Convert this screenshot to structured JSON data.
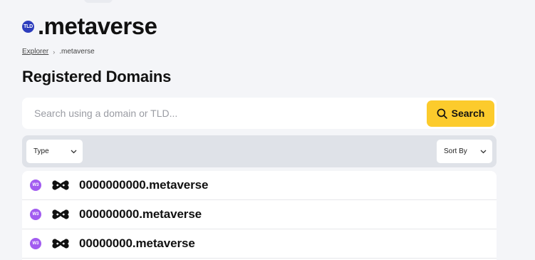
{
  "header": {
    "badge": "TLD",
    "title": ".metaverse"
  },
  "breadcrumb": {
    "root": "Explorer",
    "separator": "›",
    "current": ".metaverse"
  },
  "section_title": "Registered Domains",
  "search": {
    "placeholder": "Search using a domain or TLD...",
    "value": "",
    "button_label": "Search",
    "button_icon": "search-icon"
  },
  "filters": {
    "type_label": "Type",
    "sort_label": "Sort By"
  },
  "results": [
    {
      "badge": "W3",
      "chain_icon": "chain-logo-icon",
      "name": "0000000000.metaverse"
    },
    {
      "badge": "W3",
      "chain_icon": "chain-logo-icon",
      "name": "000000000.metaverse"
    },
    {
      "badge": "W3",
      "chain_icon": "chain-logo-icon",
      "name": "00000000.metaverse"
    }
  ],
  "colors": {
    "accent_yellow": "#fccb2c",
    "tld_badge": "#2d3dbd",
    "w3_badge": "#a25cf0",
    "background": "#f4f5f8"
  }
}
